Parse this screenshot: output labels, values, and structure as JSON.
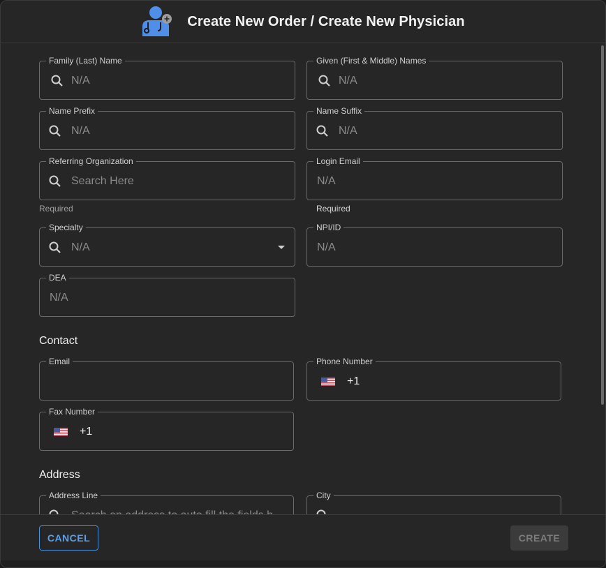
{
  "header": {
    "title": "Create New Order / Create New Physician",
    "icon": "physician-add-icon"
  },
  "colors": {
    "accent": "#4a8fd9",
    "background": "#262626",
    "border": "#6a6a6a"
  },
  "fields": {
    "family_name": {
      "label": "Family (Last) Name",
      "placeholder": "N/A"
    },
    "given_names": {
      "label": "Given (First & Middle) Names",
      "placeholder": "N/A"
    },
    "name_prefix": {
      "label": "Name Prefix",
      "placeholder": "N/A"
    },
    "name_suffix": {
      "label": "Name Suffix",
      "placeholder": "N/A"
    },
    "referring_org": {
      "label": "Referring Organization",
      "placeholder": "Search Here",
      "helper": "Required"
    },
    "login_email": {
      "label": "Login Email",
      "placeholder": "N/A",
      "helper": "Required"
    },
    "specialty": {
      "label": "Specialty",
      "placeholder": "N/A"
    },
    "npi": {
      "label": "NPI/ID",
      "placeholder": "N/A"
    },
    "dea": {
      "label": "DEA",
      "placeholder": "N/A"
    }
  },
  "contact": {
    "heading": "Contact",
    "email": {
      "label": "Email",
      "value": ""
    },
    "phone": {
      "label": "Phone Number",
      "value": "+1"
    },
    "fax": {
      "label": "Fax Number",
      "value": "+1"
    }
  },
  "address": {
    "heading": "Address",
    "line": {
      "label": "Address Line",
      "placeholder": "Search an address to auto fill the fields b"
    },
    "city": {
      "label": "City"
    }
  },
  "footer": {
    "cancel_label": "CANCEL",
    "create_label": "CREATE"
  }
}
